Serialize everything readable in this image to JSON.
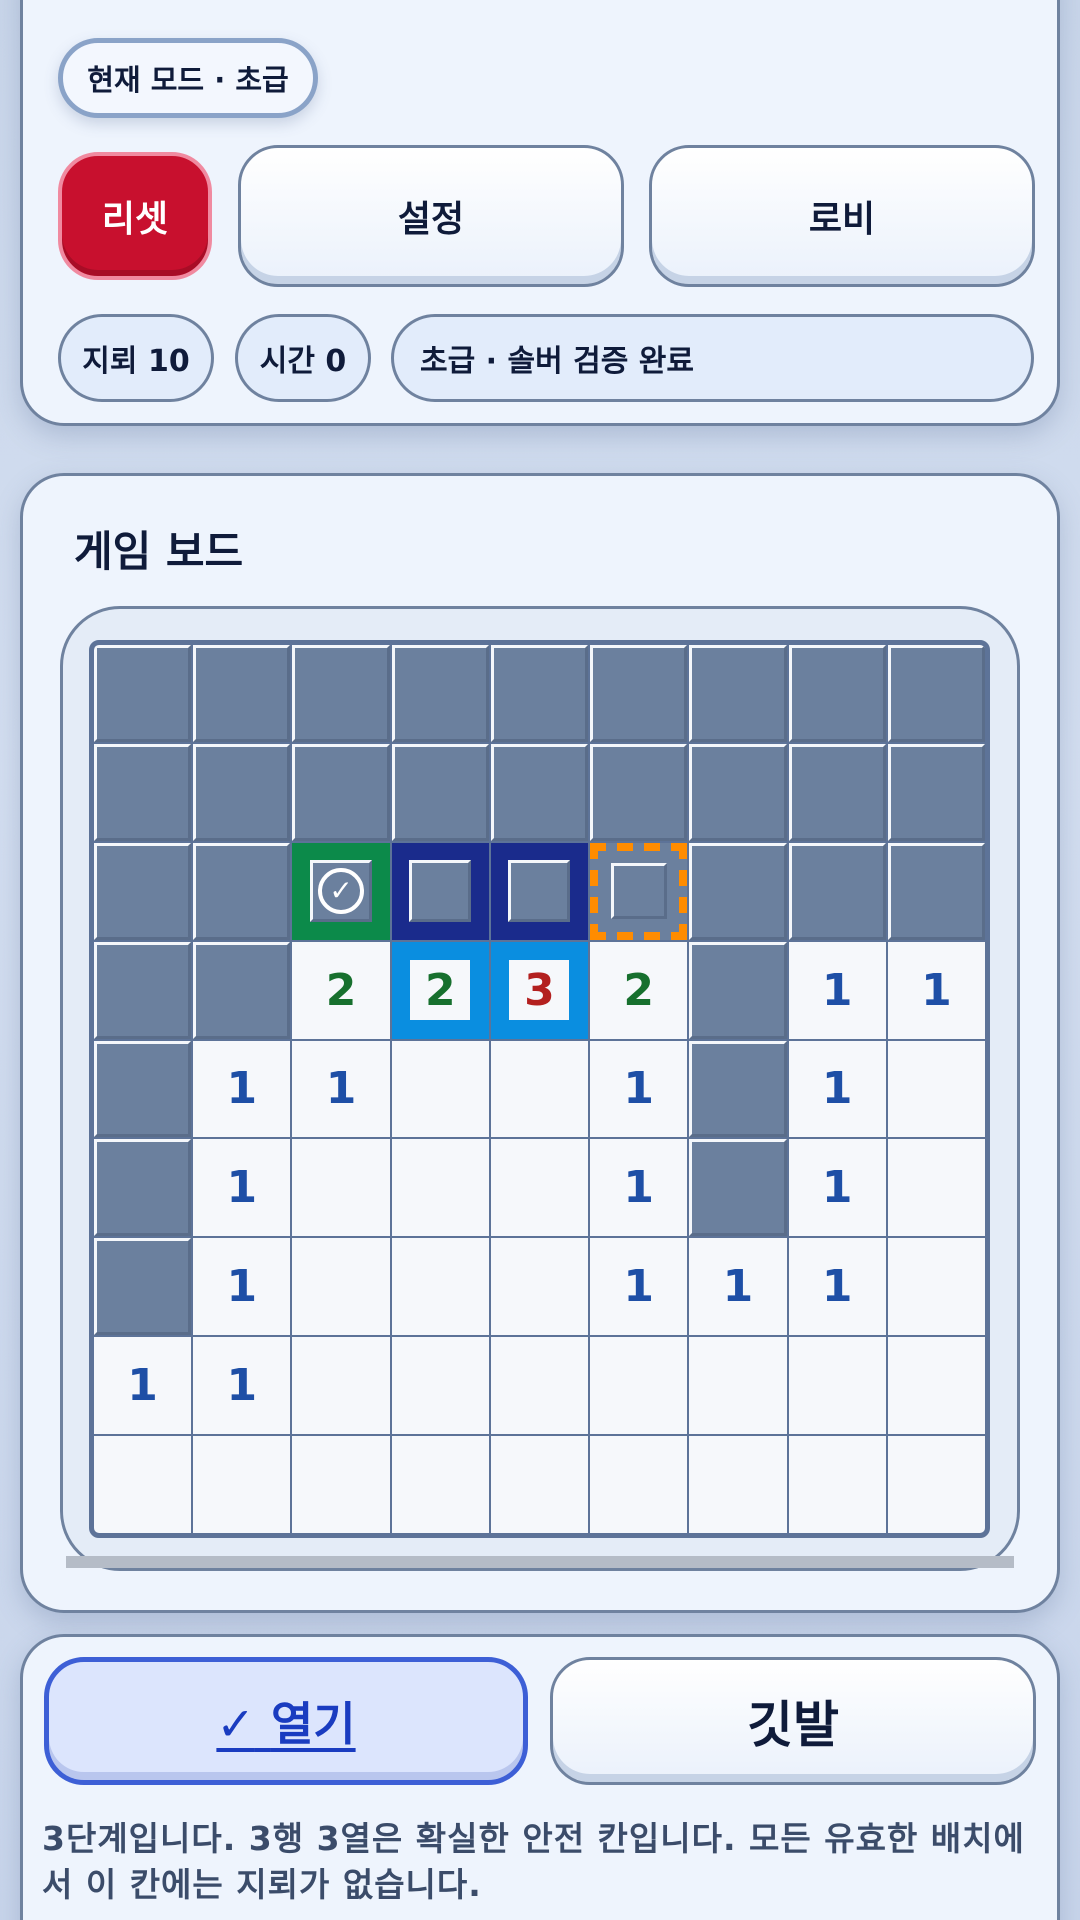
{
  "header": {
    "mode_label": "현재 모드 · 초급",
    "reset_label": "리셋",
    "settings_label": "설정",
    "lobby_label": "로비",
    "mines_label": "지뢰 10",
    "time_label": "시간 0",
    "status_label": "초급 · 솔버 검증 완료"
  },
  "board": {
    "title": "게임 보드",
    "rows": [
      [
        {
          "s": "h"
        },
        {
          "s": "h"
        },
        {
          "s": "h"
        },
        {
          "s": "h"
        },
        {
          "s": "h"
        },
        {
          "s": "h"
        },
        {
          "s": "h"
        },
        {
          "s": "h"
        },
        {
          "s": "h"
        }
      ],
      [
        {
          "s": "h"
        },
        {
          "s": "h"
        },
        {
          "s": "h"
        },
        {
          "s": "h"
        },
        {
          "s": "h"
        },
        {
          "s": "h"
        },
        {
          "s": "h"
        },
        {
          "s": "h"
        },
        {
          "s": "h"
        }
      ],
      [
        {
          "s": "h"
        },
        {
          "s": "h"
        },
        {
          "s": "h",
          "hl": "green"
        },
        {
          "s": "h",
          "hl": "navy"
        },
        {
          "s": "h",
          "hl": "navy"
        },
        {
          "s": "h",
          "hl": "orange"
        },
        {
          "s": "h"
        },
        {
          "s": "h"
        },
        {
          "s": "h"
        }
      ],
      [
        {
          "s": "h"
        },
        {
          "s": "h"
        },
        {
          "s": "r",
          "v": "2"
        },
        {
          "s": "r",
          "v": "2",
          "hl": "blue"
        },
        {
          "s": "r",
          "v": "3",
          "hl": "blue"
        },
        {
          "s": "r",
          "v": "2"
        },
        {
          "s": "h"
        },
        {
          "s": "r",
          "v": "1"
        },
        {
          "s": "r",
          "v": "1"
        }
      ],
      [
        {
          "s": "h"
        },
        {
          "s": "r",
          "v": "1"
        },
        {
          "s": "r",
          "v": "1"
        },
        {
          "s": "r",
          "v": ""
        },
        {
          "s": "r",
          "v": ""
        },
        {
          "s": "r",
          "v": "1"
        },
        {
          "s": "h"
        },
        {
          "s": "r",
          "v": "1"
        },
        {
          "s": "r",
          "v": ""
        }
      ],
      [
        {
          "s": "h"
        },
        {
          "s": "r",
          "v": "1"
        },
        {
          "s": "r",
          "v": ""
        },
        {
          "s": "r",
          "v": ""
        },
        {
          "s": "r",
          "v": ""
        },
        {
          "s": "r",
          "v": "1"
        },
        {
          "s": "h"
        },
        {
          "s": "r",
          "v": "1"
        },
        {
          "s": "r",
          "v": ""
        }
      ],
      [
        {
          "s": "h"
        },
        {
          "s": "r",
          "v": "1"
        },
        {
          "s": "r",
          "v": ""
        },
        {
          "s": "r",
          "v": ""
        },
        {
          "s": "r",
          "v": ""
        },
        {
          "s": "r",
          "v": "1"
        },
        {
          "s": "r",
          "v": "1"
        },
        {
          "s": "r",
          "v": "1"
        },
        {
          "s": "r",
          "v": ""
        }
      ],
      [
        {
          "s": "r",
          "v": "1"
        },
        {
          "s": "r",
          "v": "1"
        },
        {
          "s": "r",
          "v": ""
        },
        {
          "s": "r",
          "v": ""
        },
        {
          "s": "r",
          "v": ""
        },
        {
          "s": "r",
          "v": ""
        },
        {
          "s": "r",
          "v": ""
        },
        {
          "s": "r",
          "v": ""
        },
        {
          "s": "r",
          "v": ""
        }
      ],
      [
        {
          "s": "r",
          "v": ""
        },
        {
          "s": "r",
          "v": ""
        },
        {
          "s": "r",
          "v": ""
        },
        {
          "s": "r",
          "v": ""
        },
        {
          "s": "r",
          "v": ""
        },
        {
          "s": "r",
          "v": ""
        },
        {
          "s": "r",
          "v": ""
        },
        {
          "s": "r",
          "v": ""
        },
        {
          "s": "r",
          "v": ""
        }
      ]
    ]
  },
  "actions": {
    "open_check": "✓",
    "open_label": "열기",
    "flag_label": "깃발"
  },
  "message": "3단계입니다. 3행 3열은 확실한 안전 칸입니다. 모든 유효한 배치에서 이 칸에는 지뢰가 없습니다.",
  "colors": {
    "reset": "#c8102e",
    "safe_highlight": "#0c8a4a",
    "constraint_highlight": "#1a2b8c",
    "candidate_highlight": "#ff8c00",
    "number_highlight": "#0a8ee0",
    "number_1": "#1e4fa6",
    "number_2": "#17702e",
    "number_3": "#b3201f"
  }
}
